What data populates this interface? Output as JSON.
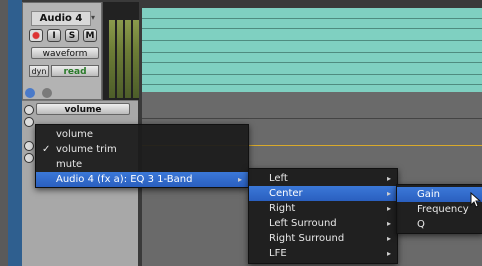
{
  "track": {
    "name": "Audio 4",
    "buttons": {
      "rec": "",
      "input": "I",
      "solo": "S",
      "mute": "M"
    },
    "view": "waveform",
    "dyn": "dyn",
    "automation_mode": "read",
    "lane_selector": "volume"
  },
  "menu_main": {
    "items": [
      {
        "label": "volume",
        "checked": false
      },
      {
        "label": "volume trim",
        "checked": true
      },
      {
        "label": "mute",
        "checked": false
      },
      {
        "label": "Audio 4  (fx a): EQ 3 1-Band",
        "selected": true,
        "submenu": true
      }
    ]
  },
  "menu_channel": {
    "items": [
      {
        "label": "Left",
        "submenu": true
      },
      {
        "label": "Center",
        "submenu": true,
        "selected": true
      },
      {
        "label": "Right",
        "submenu": true
      },
      {
        "label": "Left Surround",
        "submenu": true
      },
      {
        "label": "Right Surround",
        "submenu": true
      },
      {
        "label": "LFE",
        "submenu": true
      }
    ]
  },
  "menu_param": {
    "items": [
      {
        "label": "Gain",
        "selected": true
      },
      {
        "label": "Frequency"
      },
      {
        "label": "Q"
      }
    ]
  },
  "colors": {
    "region": "#7fd0c1",
    "automation_line": "#d9aa2b",
    "menu_highlight": "#3b78d8",
    "read_mode": "#2a7a2a"
  }
}
